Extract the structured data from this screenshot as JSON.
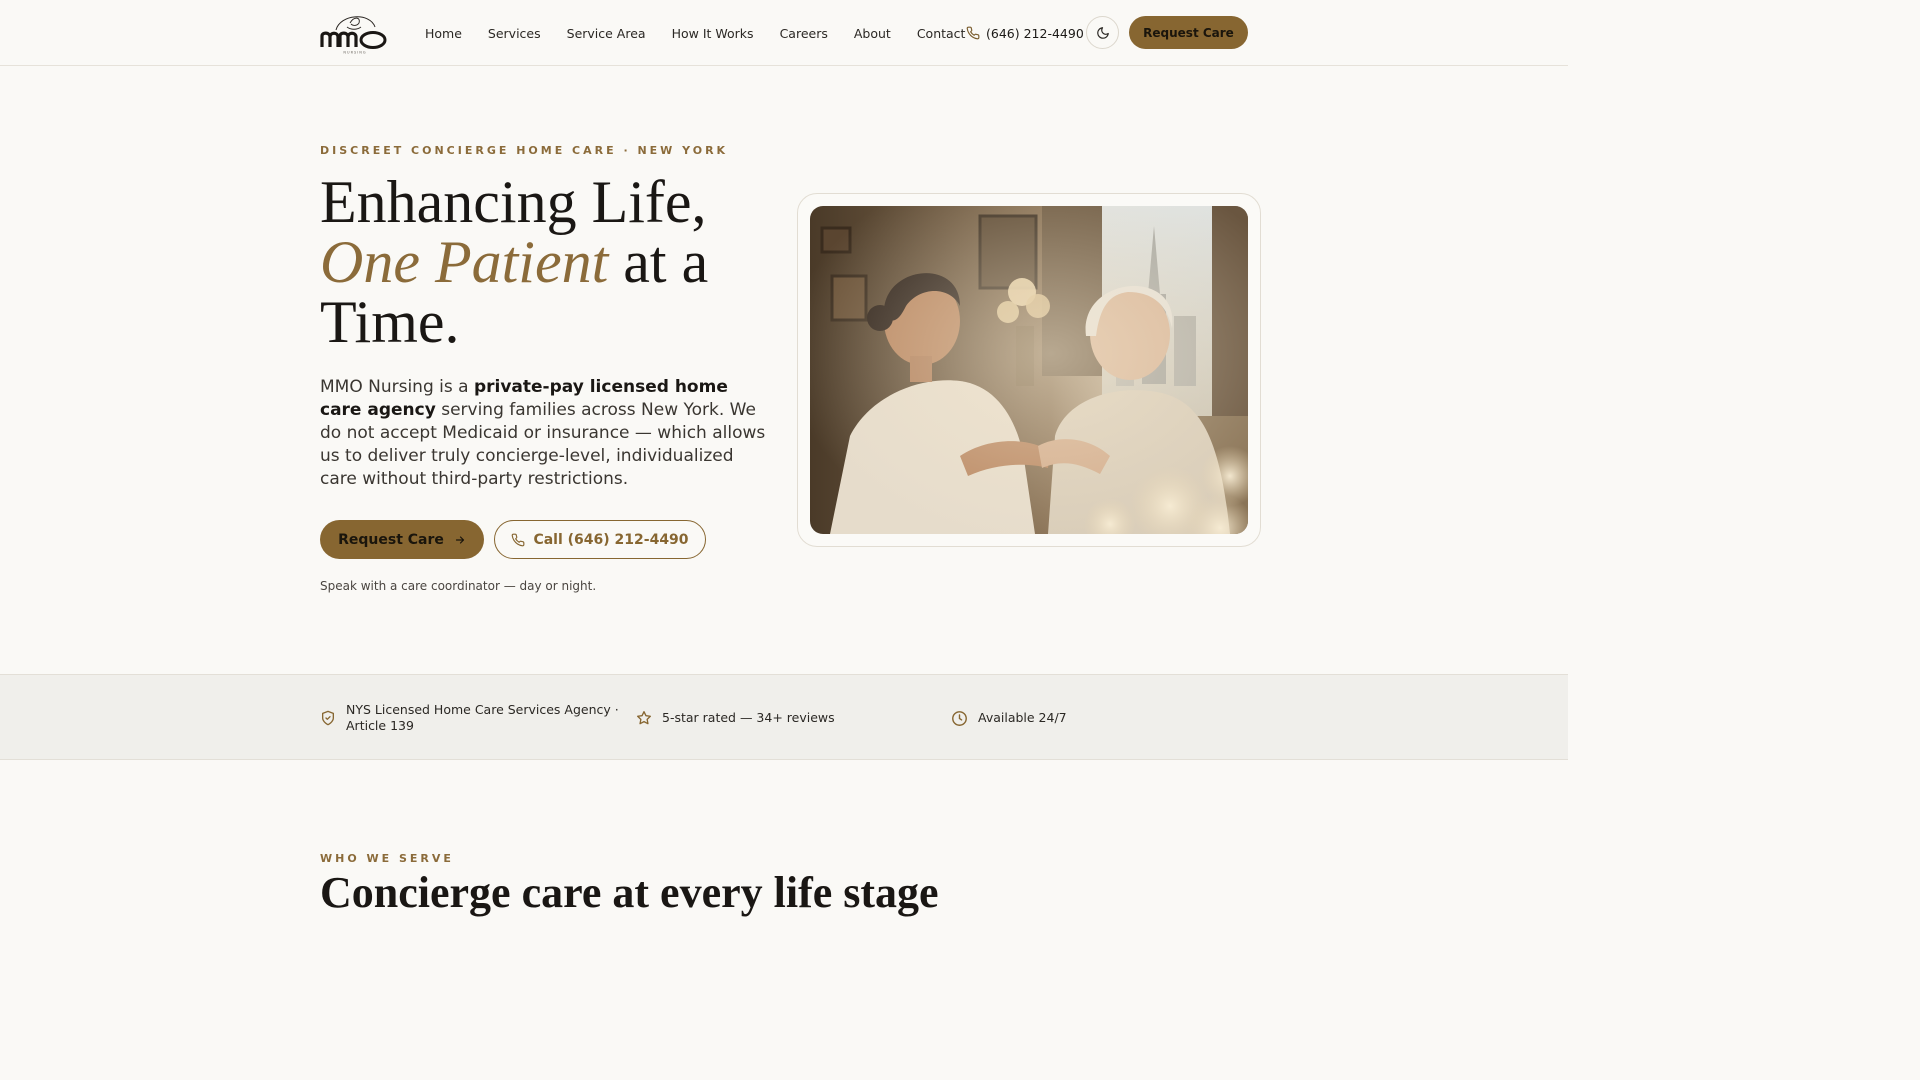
{
  "brand": {
    "logo_text": "mmo",
    "logo_subtext": "NURSING"
  },
  "nav": {
    "items": [
      {
        "label": "Home"
      },
      {
        "label": "Services"
      },
      {
        "label": "Service Area"
      },
      {
        "label": "How It Works"
      },
      {
        "label": "Careers"
      },
      {
        "label": "About"
      },
      {
        "label": "Contact"
      }
    ],
    "phone": "(646) 212-4490",
    "cta_label": "Request Care",
    "icons": {
      "phone": "phone-icon",
      "theme_toggle": "moon-icon"
    }
  },
  "hero": {
    "eyebrow": "DISCREET CONCIERGE HOME CARE · NEW YORK",
    "title_line1": "Enhancing Life,",
    "title_accent": "One Patient",
    "title_rest": " at a Time.",
    "body_intro": "MMO Nursing is a ",
    "body_bold": "private-pay licensed home care agency",
    "body_rest": " serving families across New York. We do not accept Medicaid or insurance — which allows us to deliver truly concierge-level, individualized care without third-party restrictions.",
    "primary_cta": "Request Care",
    "secondary_cta": "Call (646) 212-4490",
    "note": "Speak with a care coordinator — day or night.",
    "image_icon": "caregiver-photo"
  },
  "trust": {
    "items": [
      {
        "icon": "shield-check-icon",
        "line1": "NYS Licensed Home Care Services Agency ·",
        "line2": "Article 139"
      },
      {
        "icon": "star-icon",
        "text": "5-star rated — 34+ reviews"
      },
      {
        "icon": "clock-icon",
        "text": "Available 24/7"
      }
    ]
  },
  "serve": {
    "eyebrow": "WHO WE SERVE",
    "title": "Concierge care at every life stage"
  },
  "colors": {
    "accent": "#876631",
    "eyebrow": "#8b6b3a",
    "background": "#faf9f6",
    "trust_band": "#f0efeb",
    "text": "#1c1a17"
  }
}
